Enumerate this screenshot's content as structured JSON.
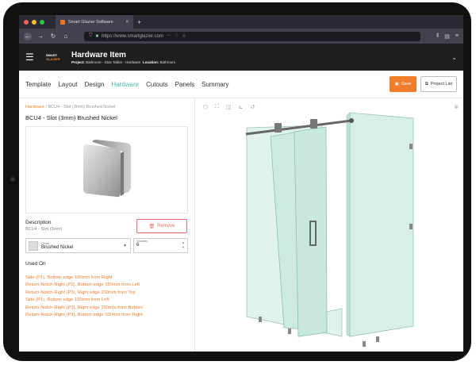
{
  "browser": {
    "tab_title": "Smart Glazier Software",
    "tab_close": "×",
    "new_tab": "+",
    "url": "https://www.smartglazier.com"
  },
  "app": {
    "brand_line1": "SMART",
    "brand_line2": "GLAZIER",
    "title": "Hardware Item",
    "project_label": "Project:",
    "project_value": "Bathroom - Glas Tablet - Hardware",
    "location_label": "Location:",
    "location_value": "Bathroom"
  },
  "tabs": [
    {
      "label": "Template"
    },
    {
      "label": "Layout"
    },
    {
      "label": "Design"
    },
    {
      "label": "Hardware"
    },
    {
      "label": "Cutouts"
    },
    {
      "label": "Panels"
    },
    {
      "label": "Summary"
    }
  ],
  "actions": {
    "save": "Save",
    "project_list": "Project List"
  },
  "item": {
    "crumb_parent": "Hardware",
    "crumb_sep": " / ",
    "crumb_current": "BCU4 - Slot (3mm) Brushed Nickel",
    "title": "BCU4 - Slot (3mm) Brushed Nickel",
    "description_label": "Description",
    "description_value": "BCU4 - Slot (3mm)",
    "remove": "Remove",
    "finish_label": "Finish",
    "finish_value": "Brushed Nickel",
    "quantity_label": "Quantity",
    "quantity_value": "6",
    "used_on_label": "Used On",
    "used_on": [
      "Side (P1), Bottom edge 100mm from Right",
      "Return-Notch-Right (P3), Bottom edge 150mm from Left",
      "Return-Notch-Right (P3), Right edge 200mm from Top",
      "Side (P1), Bottom edge 100mm from Left",
      "Return-Notch-Right (P3), Right edge 250mm from Bottom",
      "Return-Notch-Right (P3), Bottom edge 100mm from Right"
    ]
  },
  "colors": {
    "accent": "#f07d2c",
    "active_tab": "#4bb8b0",
    "remove": "#e07068"
  }
}
